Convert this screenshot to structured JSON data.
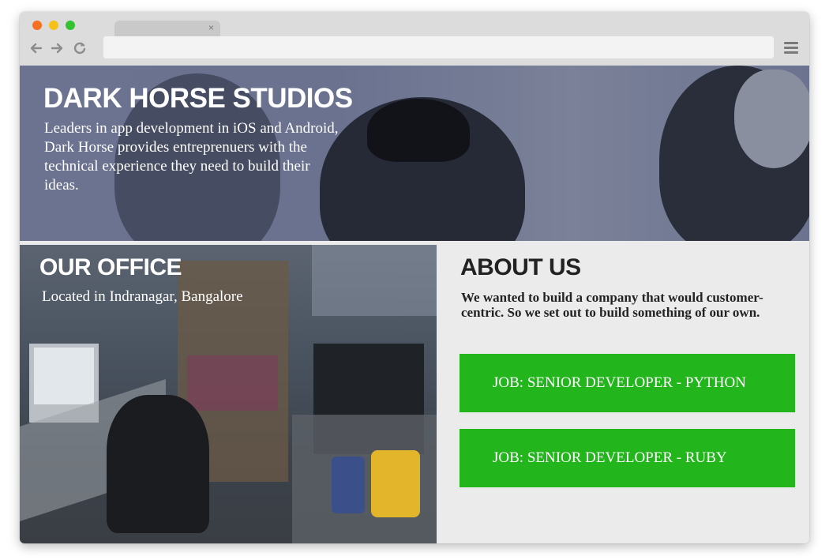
{
  "browser": {
    "tab_close": "×",
    "icons": {
      "back": "left-arrow-icon",
      "forward": "right-arrow-icon",
      "reload": "reload-icon",
      "menu": "hamburger-menu-icon"
    }
  },
  "hero": {
    "title": "DARK HORSE STUDIOS",
    "text": "Leaders in app development in iOS and Android, Dark Horse provides entreprenuers with the technical experience they need to build their ideas."
  },
  "office": {
    "title": "OUR OFFICE",
    "subtitle": "Located in Indranagar, Bangalore"
  },
  "about": {
    "title": "ABOUT US",
    "text": "We wanted to build a company that would customer-centric. So we set out to build something of our own.",
    "jobs": [
      {
        "label": "JOB: SENIOR DEVELOPER - PYTHON"
      },
      {
        "label": "JOB: SENIOR DEVELOPER - RUBY"
      }
    ]
  },
  "colors": {
    "accent": "#22b61c",
    "hero_overlay": "#6b7390",
    "text_dark": "#222222"
  }
}
